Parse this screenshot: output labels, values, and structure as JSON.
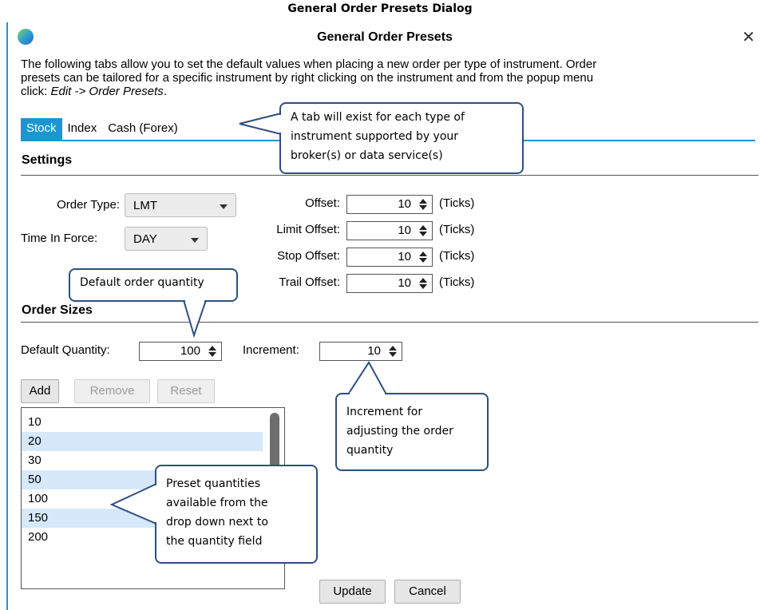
{
  "figure_caption": "General Order Presets Dialog",
  "dialog": {
    "title": "General Order Presets",
    "close_glyph": "✕",
    "intro_1": "The following tabs allow you to set the default values when placing a new order per type of instrument.  Order",
    "intro_2": "presets can be tailored for a specific instrument by right clicking on the instrument and from the popup menu",
    "intro_3_prefix": "click: ",
    "intro_3_italic": "Edit -> Order Presets",
    "intro_3_suffix": "."
  },
  "tabs": [
    "Stock",
    "Index",
    "Cash (Forex)"
  ],
  "settings": {
    "heading": "Settings",
    "order_type_label": "Order Type:",
    "order_type_value": "LMT",
    "tif_label": "Time In Force:",
    "tif_value": "DAY",
    "offsets": [
      {
        "label": "Offset:",
        "value": "10",
        "unit": "(Ticks)"
      },
      {
        "label": "Limit Offset:",
        "value": "10",
        "unit": "(Ticks)"
      },
      {
        "label": "Stop Offset:",
        "value": "10",
        "unit": "(Ticks)"
      },
      {
        "label": "Trail Offset:",
        "value": "10",
        "unit": "(Ticks)"
      }
    ]
  },
  "order_sizes": {
    "heading": "Order Sizes",
    "default_qty_label": "Default Quantity:",
    "default_qty_value": "100",
    "increment_label": "Increment:",
    "increment_value": "10",
    "add_label": "Add",
    "remove_label": "Remove",
    "reset_label": "Reset",
    "quantities": [
      "10",
      "20",
      "30",
      "50",
      "100",
      "150",
      "200"
    ]
  },
  "footer": {
    "update_label": "Update",
    "cancel_label": "Cancel"
  },
  "callouts": {
    "tabs": [
      "A tab will exist for each type of",
      "instrument supported by your",
      "broker(s) or data service(s)"
    ],
    "default_qty": [
      "Default order quantity"
    ],
    "increment": [
      "Increment for",
      "adjusting the order",
      "quantity"
    ],
    "presets": [
      "Preset quantities",
      "available from the",
      "drop down next to",
      "the quantity field"
    ]
  },
  "colors": {
    "accent": "#1b96d1",
    "selected_row": "#d5e9fb",
    "callout_border": "#2f4f7f"
  }
}
